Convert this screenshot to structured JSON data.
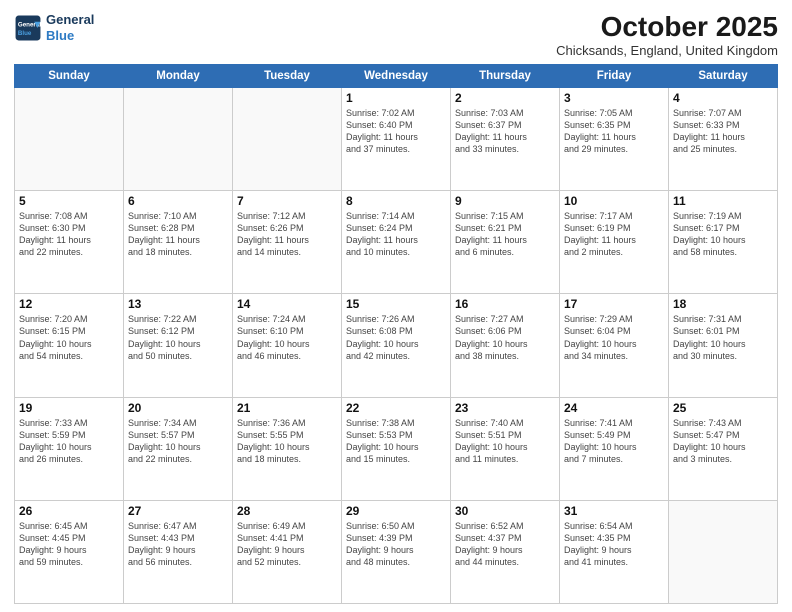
{
  "header": {
    "logo_line1": "General",
    "logo_line2": "Blue",
    "month": "October 2025",
    "location": "Chicksands, England, United Kingdom"
  },
  "weekdays": [
    "Sunday",
    "Monday",
    "Tuesday",
    "Wednesday",
    "Thursday",
    "Friday",
    "Saturday"
  ],
  "weeks": [
    [
      {
        "day": "",
        "info": ""
      },
      {
        "day": "",
        "info": ""
      },
      {
        "day": "",
        "info": ""
      },
      {
        "day": "1",
        "info": "Sunrise: 7:02 AM\nSunset: 6:40 PM\nDaylight: 11 hours\nand 37 minutes."
      },
      {
        "day": "2",
        "info": "Sunrise: 7:03 AM\nSunset: 6:37 PM\nDaylight: 11 hours\nand 33 minutes."
      },
      {
        "day": "3",
        "info": "Sunrise: 7:05 AM\nSunset: 6:35 PM\nDaylight: 11 hours\nand 29 minutes."
      },
      {
        "day": "4",
        "info": "Sunrise: 7:07 AM\nSunset: 6:33 PM\nDaylight: 11 hours\nand 25 minutes."
      }
    ],
    [
      {
        "day": "5",
        "info": "Sunrise: 7:08 AM\nSunset: 6:30 PM\nDaylight: 11 hours\nand 22 minutes."
      },
      {
        "day": "6",
        "info": "Sunrise: 7:10 AM\nSunset: 6:28 PM\nDaylight: 11 hours\nand 18 minutes."
      },
      {
        "day": "7",
        "info": "Sunrise: 7:12 AM\nSunset: 6:26 PM\nDaylight: 11 hours\nand 14 minutes."
      },
      {
        "day": "8",
        "info": "Sunrise: 7:14 AM\nSunset: 6:24 PM\nDaylight: 11 hours\nand 10 minutes."
      },
      {
        "day": "9",
        "info": "Sunrise: 7:15 AM\nSunset: 6:21 PM\nDaylight: 11 hours\nand 6 minutes."
      },
      {
        "day": "10",
        "info": "Sunrise: 7:17 AM\nSunset: 6:19 PM\nDaylight: 11 hours\nand 2 minutes."
      },
      {
        "day": "11",
        "info": "Sunrise: 7:19 AM\nSunset: 6:17 PM\nDaylight: 10 hours\nand 58 minutes."
      }
    ],
    [
      {
        "day": "12",
        "info": "Sunrise: 7:20 AM\nSunset: 6:15 PM\nDaylight: 10 hours\nand 54 minutes."
      },
      {
        "day": "13",
        "info": "Sunrise: 7:22 AM\nSunset: 6:12 PM\nDaylight: 10 hours\nand 50 minutes."
      },
      {
        "day": "14",
        "info": "Sunrise: 7:24 AM\nSunset: 6:10 PM\nDaylight: 10 hours\nand 46 minutes."
      },
      {
        "day": "15",
        "info": "Sunrise: 7:26 AM\nSunset: 6:08 PM\nDaylight: 10 hours\nand 42 minutes."
      },
      {
        "day": "16",
        "info": "Sunrise: 7:27 AM\nSunset: 6:06 PM\nDaylight: 10 hours\nand 38 minutes."
      },
      {
        "day": "17",
        "info": "Sunrise: 7:29 AM\nSunset: 6:04 PM\nDaylight: 10 hours\nand 34 minutes."
      },
      {
        "day": "18",
        "info": "Sunrise: 7:31 AM\nSunset: 6:01 PM\nDaylight: 10 hours\nand 30 minutes."
      }
    ],
    [
      {
        "day": "19",
        "info": "Sunrise: 7:33 AM\nSunset: 5:59 PM\nDaylight: 10 hours\nand 26 minutes."
      },
      {
        "day": "20",
        "info": "Sunrise: 7:34 AM\nSunset: 5:57 PM\nDaylight: 10 hours\nand 22 minutes."
      },
      {
        "day": "21",
        "info": "Sunrise: 7:36 AM\nSunset: 5:55 PM\nDaylight: 10 hours\nand 18 minutes."
      },
      {
        "day": "22",
        "info": "Sunrise: 7:38 AM\nSunset: 5:53 PM\nDaylight: 10 hours\nand 15 minutes."
      },
      {
        "day": "23",
        "info": "Sunrise: 7:40 AM\nSunset: 5:51 PM\nDaylight: 10 hours\nand 11 minutes."
      },
      {
        "day": "24",
        "info": "Sunrise: 7:41 AM\nSunset: 5:49 PM\nDaylight: 10 hours\nand 7 minutes."
      },
      {
        "day": "25",
        "info": "Sunrise: 7:43 AM\nSunset: 5:47 PM\nDaylight: 10 hours\nand 3 minutes."
      }
    ],
    [
      {
        "day": "26",
        "info": "Sunrise: 6:45 AM\nSunset: 4:45 PM\nDaylight: 9 hours\nand 59 minutes."
      },
      {
        "day": "27",
        "info": "Sunrise: 6:47 AM\nSunset: 4:43 PM\nDaylight: 9 hours\nand 56 minutes."
      },
      {
        "day": "28",
        "info": "Sunrise: 6:49 AM\nSunset: 4:41 PM\nDaylight: 9 hours\nand 52 minutes."
      },
      {
        "day": "29",
        "info": "Sunrise: 6:50 AM\nSunset: 4:39 PM\nDaylight: 9 hours\nand 48 minutes."
      },
      {
        "day": "30",
        "info": "Sunrise: 6:52 AM\nSunset: 4:37 PM\nDaylight: 9 hours\nand 44 minutes."
      },
      {
        "day": "31",
        "info": "Sunrise: 6:54 AM\nSunset: 4:35 PM\nDaylight: 9 hours\nand 41 minutes."
      },
      {
        "day": "",
        "info": ""
      }
    ]
  ]
}
